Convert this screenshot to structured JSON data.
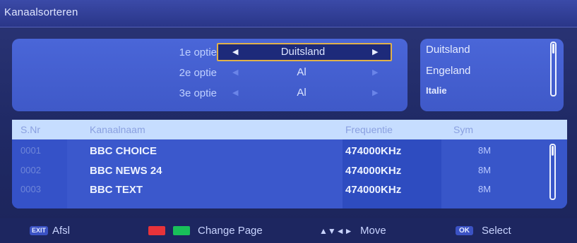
{
  "title": "Kanaalsorteren",
  "options": [
    {
      "label": "1e optie",
      "value": "Duitsland",
      "active": true
    },
    {
      "label": "2e optie",
      "value": "Al",
      "active": false
    },
    {
      "label": "3e optie",
      "value": "Al",
      "active": false
    }
  ],
  "country_list": [
    "Duitsland",
    "Engeland",
    "Italie"
  ],
  "table": {
    "headers": {
      "nr": "S.Nr",
      "name": "Kanaalnaam",
      "freq": "Frequentie",
      "sym": "Sym"
    },
    "rows": [
      {
        "nr": "0001",
        "name": "BBC CHOICE",
        "freq": "474000KHz",
        "sym": "8M"
      },
      {
        "nr": "0002",
        "name": "BBC NEWS 24",
        "freq": "474000KHz",
        "sym": "8M"
      },
      {
        "nr": "0003",
        "name": "BBC TEXT",
        "freq": "474000KHz",
        "sym": "8M"
      }
    ]
  },
  "footer": {
    "exit_key": "EXIT",
    "exit_label": "Afsl",
    "change_page_label": "Change Page",
    "move_label": "Move",
    "ok_key": "OK",
    "select_label": "Select"
  },
  "colors": {
    "red_key": "#e8333a",
    "green_key": "#19c05a",
    "highlight": "#e0b14a"
  },
  "icons": [
    "arrow-left-icon",
    "arrow-right-icon",
    "arrow-up-icon",
    "arrow-down-icon",
    "arrow-leftright-icon"
  ]
}
